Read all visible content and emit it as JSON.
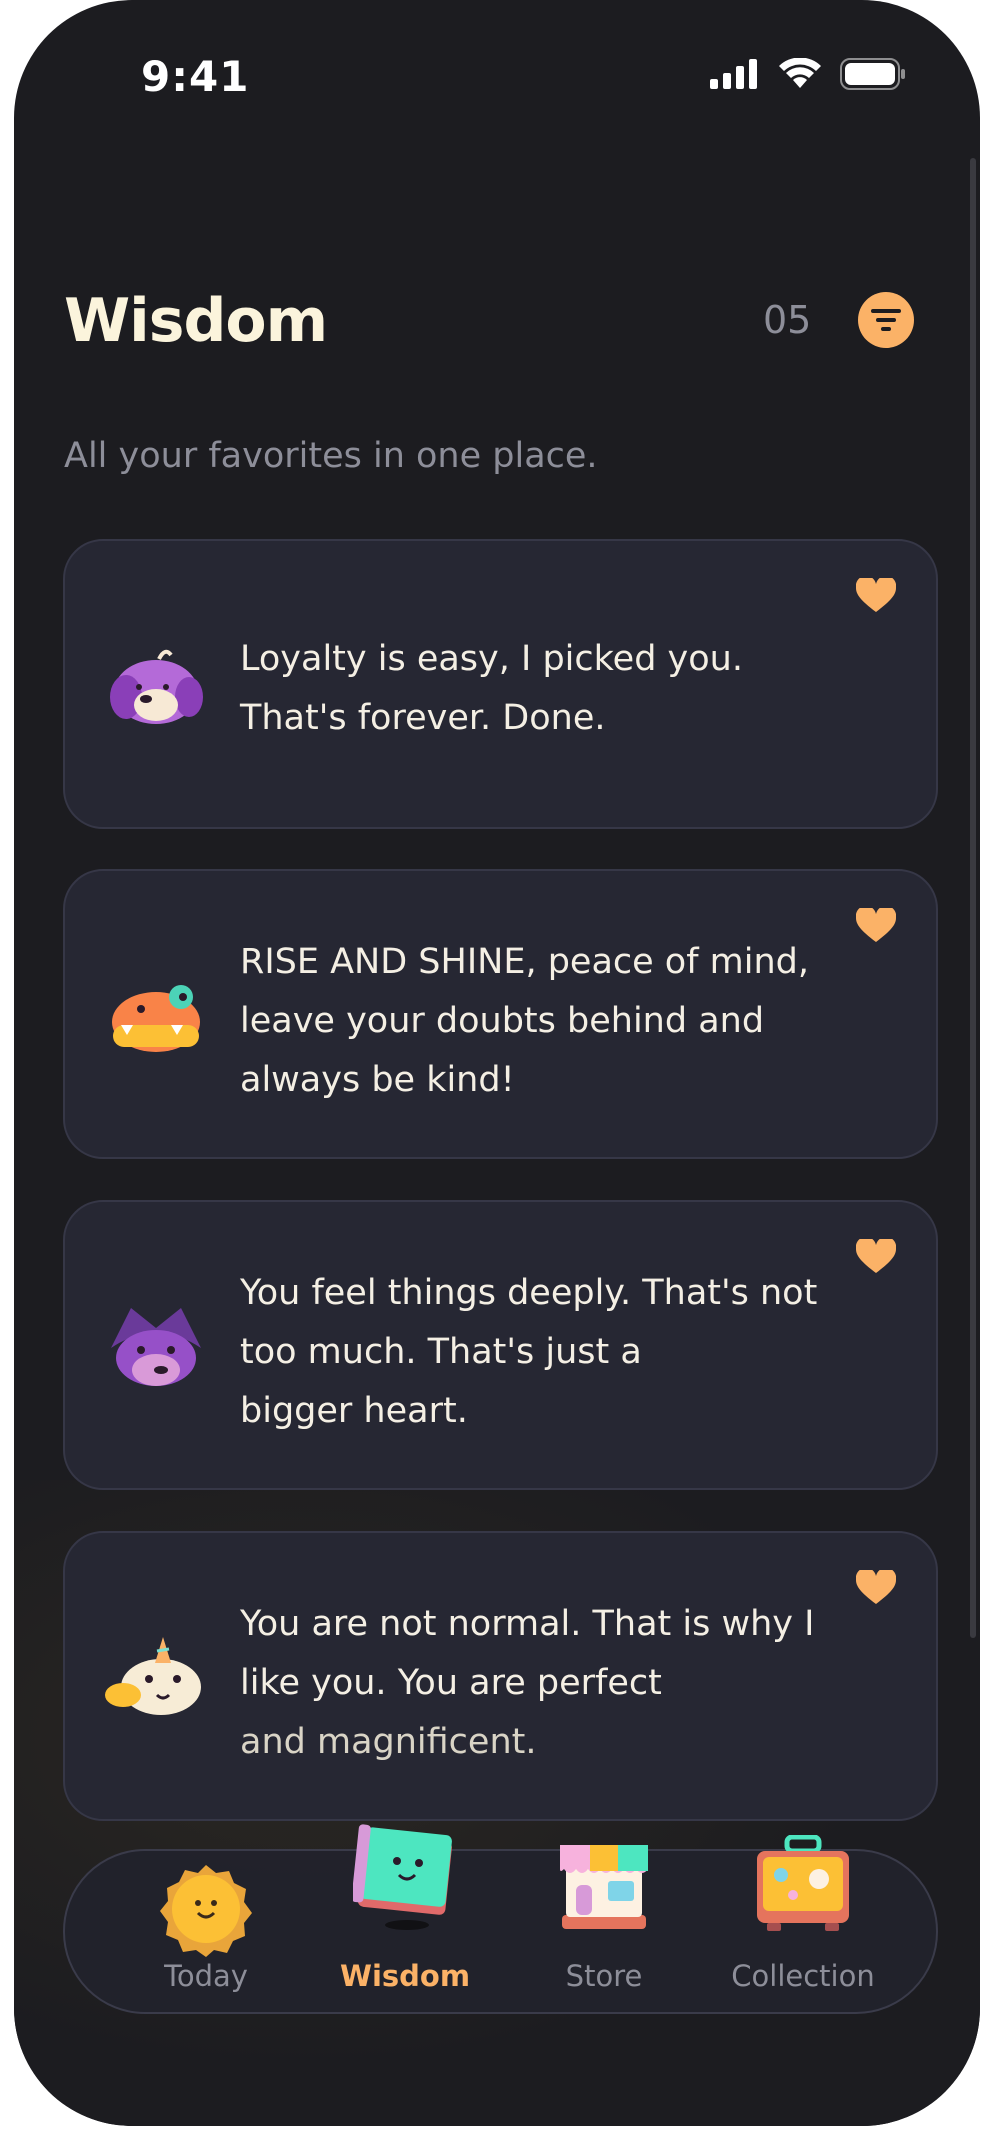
{
  "status": {
    "time": "9:41"
  },
  "header": {
    "title": "Wisdom",
    "count": "05"
  },
  "subtitle": "All your favorites in one place.",
  "cards": [
    {
      "lines": [
        "Loyalty is easy, I picked you.",
        "That's forever. Done."
      ],
      "character": "purple-dog-icon"
    },
    {
      "lines": [
        "RISE AND SHINE, peace of mind,",
        "leave your doubts behind and",
        "always be kind!"
      ],
      "character": "orange-crocodile-icon"
    },
    {
      "lines": [
        "You feel things deeply. That's not",
        "too much. That's just a",
        "bigger heart."
      ],
      "character": "purple-bat-icon"
    },
    {
      "lines": [
        "You are not normal. That is why I",
        "like you. You are perfect",
        "and magnificent."
      ],
      "character": "unicorn-cow-icon"
    }
  ],
  "tabs": [
    {
      "label": "Today",
      "icon": "sun-icon"
    },
    {
      "label": "Wisdom",
      "icon": "book-icon",
      "active": true
    },
    {
      "label": "Store",
      "icon": "store-icon"
    },
    {
      "label": "Collection",
      "icon": "suitcase-icon"
    }
  ],
  "colors": {
    "accent": "#fbb267",
    "background": "#1c1c20",
    "card": "#262733",
    "title": "#fbf4dc"
  }
}
